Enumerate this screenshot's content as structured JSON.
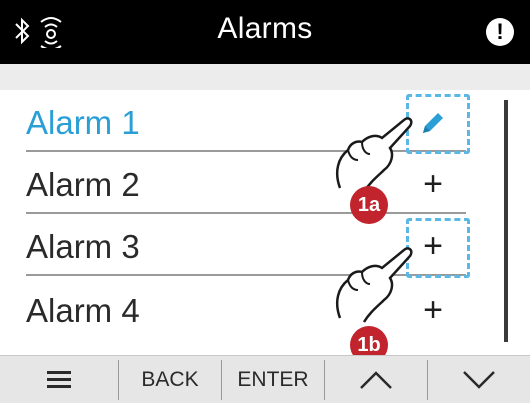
{
  "status_bar": {
    "title": "Alarms",
    "icons": [
      "bluetooth-icon",
      "wireless-signal-icon",
      "warning-icon"
    ],
    "warning_symbol": "!"
  },
  "alarms": [
    {
      "label": "Alarm 1",
      "action_icon": "pencil-icon",
      "selected": true
    },
    {
      "label": "Alarm 2",
      "action_icon": "plus-icon",
      "action_text": "+"
    },
    {
      "label": "Alarm 3",
      "action_icon": "plus-icon",
      "action_text": "+"
    },
    {
      "label": "Alarm 4",
      "action_icon": "plus-icon",
      "action_text": "+"
    }
  ],
  "callouts": {
    "a": "1a",
    "b": "1b"
  },
  "toolbar": {
    "menu_icon": "menu-icon",
    "back_label": "BACK",
    "enter_label": "ENTER",
    "up_icon": "chevron-up-icon",
    "down_icon": "chevron-down-icon"
  },
  "colors": {
    "accent": "#2a9fd6",
    "highlight": "#5ab7e6",
    "badge": "#c1242c",
    "status_bar": "#000000"
  }
}
